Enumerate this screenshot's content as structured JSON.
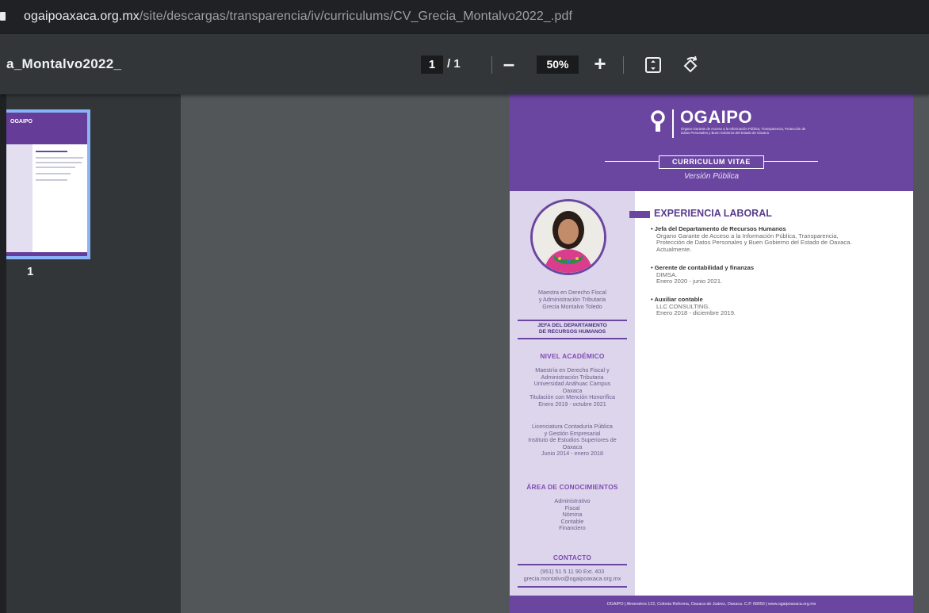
{
  "browser": {
    "url_host": "ogaipoaxaca.org.mx",
    "url_path": "/site/descargas/transparencia/iv/curriculums/CV_Grecia_Montalvo2022_.pdf"
  },
  "toolbar": {
    "title": "a_Montalvo2022_",
    "current_page": "1",
    "page_total": "/ 1",
    "zoom_out_label": "–",
    "zoom": "50%",
    "zoom_in_label": "+"
  },
  "thumbnail": {
    "page_label": "1",
    "logo_text": "OGAIPO"
  },
  "document": {
    "logo_text": "OGAIPO",
    "logo_subtext": "Órgano Garante de Acceso a la Información Pública, Transparencia, Protección de Datos Personales y Buen Gobierno del Estado de Oaxaca",
    "cv_label": "CURRICULUM VITAE",
    "cv_subtitle": "Versión Pública",
    "profile": {
      "line1": "Maestra en Derecho Fiscal",
      "line2": "y Administración Tributaria",
      "line3": "Grecia Montalvo Toledo"
    },
    "role_line1": "JEFA DEL DEPARTAMENTO",
    "role_line2": "DE RECURSOS HUMANOS",
    "academic_heading": "NIVEL ACADÉMICO",
    "academic1": [
      "Maestría en Derecho Fiscal y",
      "Administración Tributaria",
      "Universidad Anáhuac Campus",
      "Oaxaca",
      "Titulación con Mención Honorífica",
      "Enero 2019 - octubre 2021"
    ],
    "academic2": [
      "Licenciatura Contaduría Pública",
      "y Gestión Empresarial",
      "Instituto de Estudios Superiores de",
      "Oaxaca",
      "Junio 2014 - enero 2018"
    ],
    "knowledge_heading": "ÁREA DE CONOCIMIENTOS",
    "knowledge": [
      "Administrativo",
      "Fiscal",
      "Nómina",
      "Contable",
      "Financiero"
    ],
    "contact_heading": "CONTACTO",
    "contact_phone": "(951) 51 5 11 90 Ext. 403",
    "contact_email": "grecia.montalvo@ogaipoaxaca.org.mx",
    "experience_heading": "EXPERIENCIA LABORAL",
    "jobs": [
      {
        "title": "• Jefa del Departamento de Recursos Humanos",
        "line1": "Órgano Garante de Acceso a la Información Pública, Transparencia,",
        "line2": "Protección de Datos Personales y Buen Gobierno del Estado de Oaxaca.",
        "line3": "Actualmente."
      },
      {
        "title": "• Gerente de contabilidad y finanzas",
        "line1": "DIMSA.",
        "line2": "Enero 2020 - junio 2021."
      },
      {
        "title": "• Auxiliar contable",
        "line1": "LLC CONSULTING.",
        "line2": "Enero 2018 - diciembre 2019."
      }
    ],
    "footer": "OGAIPO | Almendros 122, Colonia Reforma, Oaxaca de Juárez, Oaxaca. C.P. 68050 | www.ogaipoaxaca.org.mx"
  },
  "colors": {
    "brand_purple": "#6b46a1",
    "panel_lavender": "#ddd5ec",
    "toolbar": "#323639",
    "viewer_bg": "#525659"
  },
  "icons": [
    "lock-icon",
    "fit-page-icon",
    "rotate-icon"
  ]
}
